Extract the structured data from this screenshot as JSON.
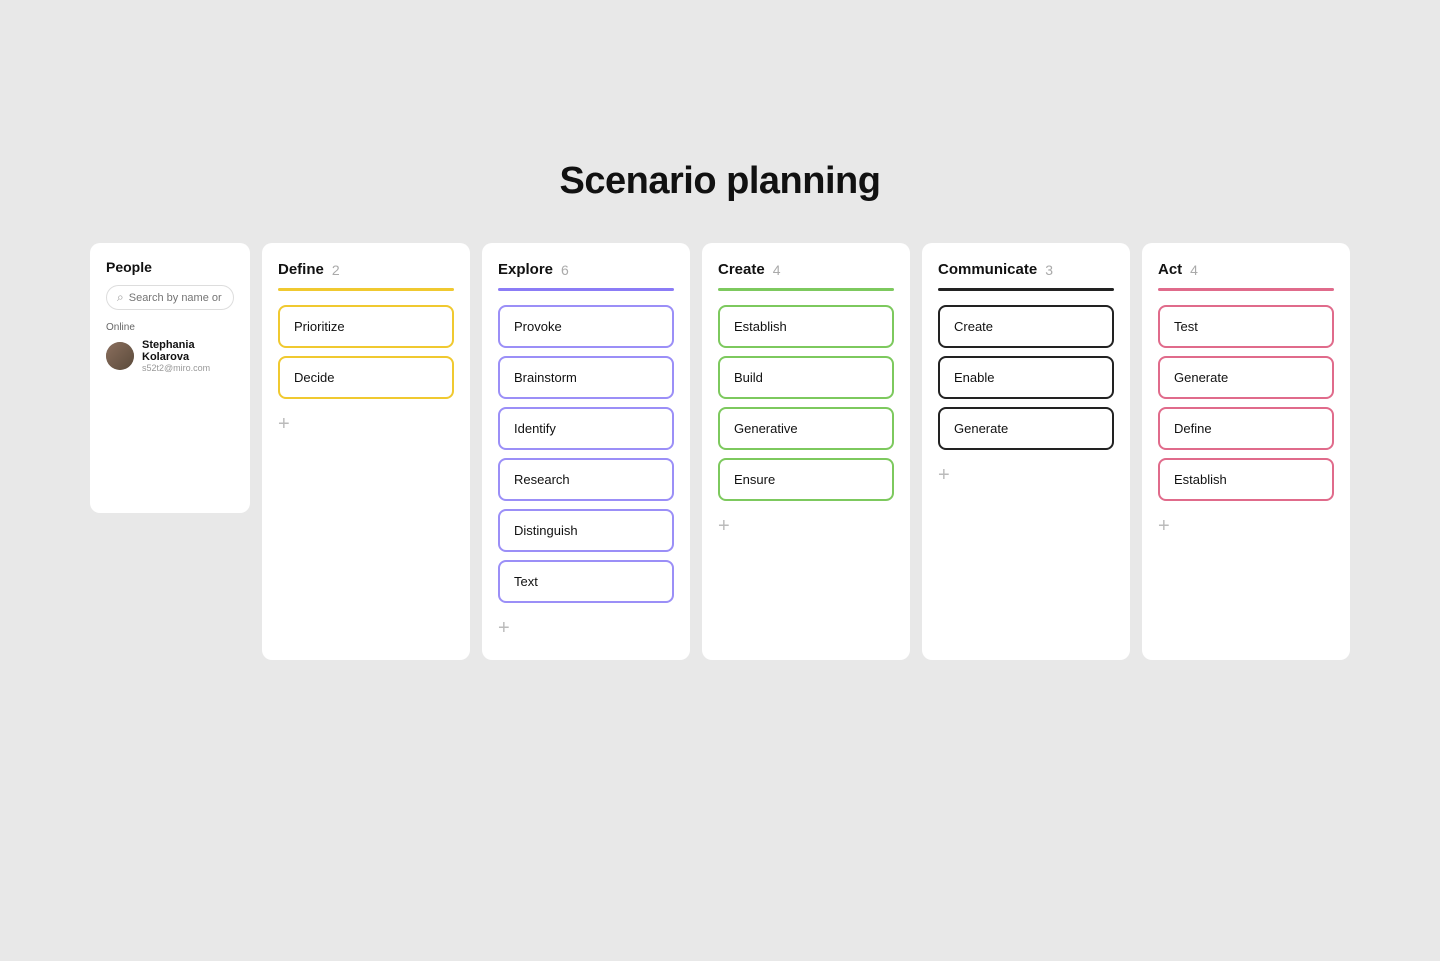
{
  "page": {
    "title": "Scenario planning"
  },
  "people": {
    "title": "People",
    "search_placeholder": "Search by name or email",
    "online_label": "Online",
    "users": [
      {
        "name": "Stephania Kolarova",
        "email": "s52t2@miro.com"
      }
    ]
  },
  "columns": [
    {
      "id": "define",
      "title": "Define",
      "count": "2",
      "color_class": "define-divider",
      "card_class": "card-yellow",
      "cards": [
        "Prioritize",
        "Decide"
      ],
      "add_label": "+"
    },
    {
      "id": "explore",
      "title": "Explore",
      "count": "6",
      "color_class": "explore-divider",
      "card_class": "card-purple",
      "cards": [
        "Provoke",
        "Brainstorm",
        "Identify",
        "Research",
        "Distinguish",
        "Text"
      ],
      "add_label": "+"
    },
    {
      "id": "create",
      "title": "Create",
      "count": "4",
      "color_class": "create-divider",
      "card_class": "card-green",
      "cards": [
        "Establish",
        "Build",
        "Generative",
        "Ensure"
      ],
      "add_label": "+"
    },
    {
      "id": "communicate",
      "title": "Communicate",
      "count": "3",
      "color_class": "communicate-divider",
      "card_class": "card-dark",
      "cards": [
        "Create",
        "Enable",
        "Generate"
      ],
      "add_label": "+"
    },
    {
      "id": "act",
      "title": "Act",
      "count": "4",
      "color_class": "act-divider",
      "card_class": "card-pink",
      "cards": [
        "Test",
        "Generate",
        "Define",
        "Establish"
      ],
      "add_label": "+"
    }
  ]
}
